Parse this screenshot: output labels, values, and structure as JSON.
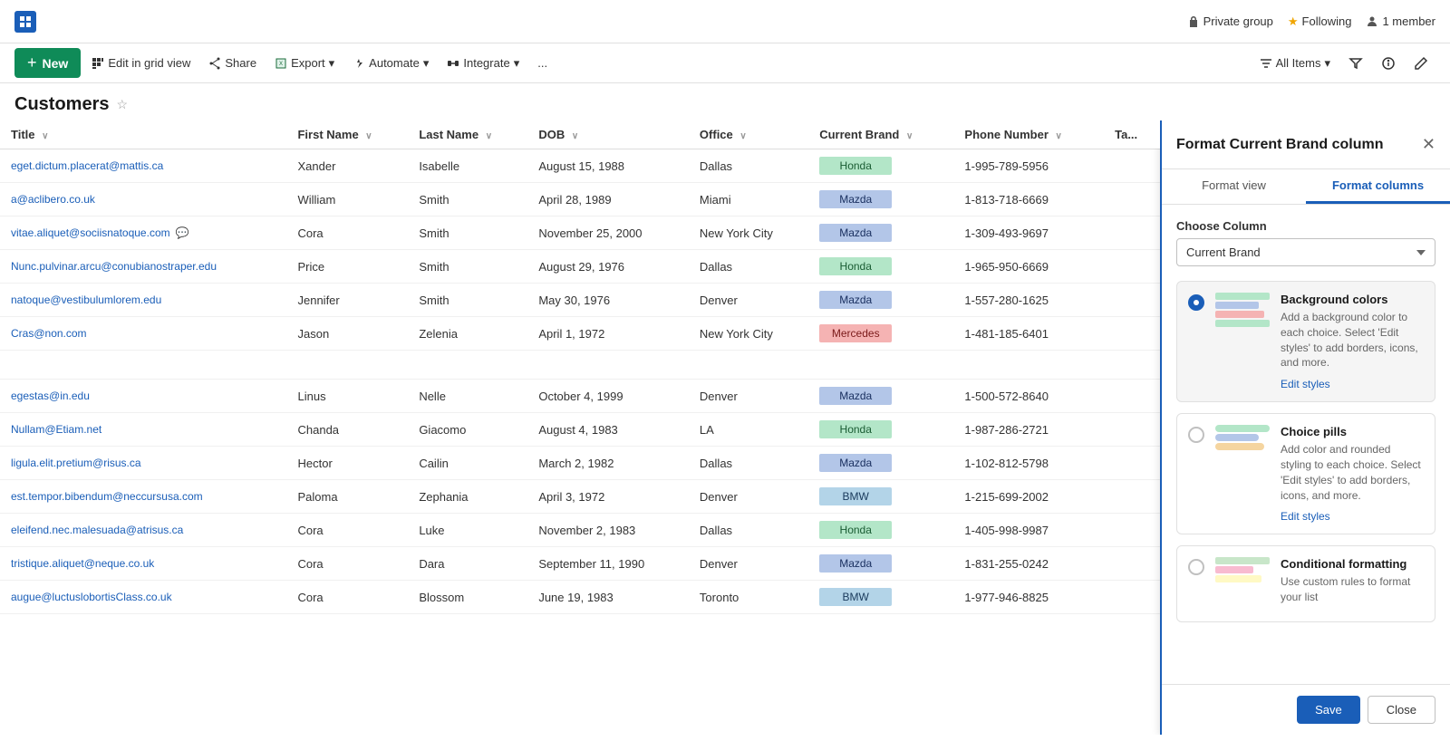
{
  "topbar": {
    "private_group": "Private group",
    "following_label": "Following",
    "member_label": "1 member"
  },
  "toolbar": {
    "new_label": "New",
    "edit_grid_label": "Edit in grid view",
    "share_label": "Share",
    "export_label": "Export",
    "automate_label": "Automate",
    "integrate_label": "Integrate",
    "more_label": "...",
    "all_items_label": "All Items"
  },
  "page": {
    "title": "Customers"
  },
  "table": {
    "columns": [
      "Title",
      "First Name",
      "Last Name",
      "DOB",
      "Office",
      "Current Brand",
      "Phone Number",
      "Ta..."
    ],
    "rows": [
      {
        "title": "eget.dictum.placerat@mattis.ca",
        "first_name": "Xander",
        "last_name": "Isabelle",
        "dob": "August 15, 1988",
        "office": "Dallas",
        "brand": "Honda",
        "brand_class": "brand-honda",
        "phone": "1-995-789-5956",
        "has_chat": false
      },
      {
        "title": "a@aclibero.co.uk",
        "first_name": "William",
        "last_name": "Smith",
        "dob": "April 28, 1989",
        "office": "Miami",
        "brand": "Mazda",
        "brand_class": "brand-mazda",
        "phone": "1-813-718-6669",
        "has_chat": false
      },
      {
        "title": "vitae.aliquet@sociisnatoque.com",
        "first_name": "Cora",
        "last_name": "Smith",
        "dob": "November 25, 2000",
        "office": "New York City",
        "brand": "Mazda",
        "brand_class": "brand-mazda",
        "phone": "1-309-493-9697",
        "has_chat": true
      },
      {
        "title": "Nunc.pulvinar.arcu@conubianostraper.edu",
        "first_name": "Price",
        "last_name": "Smith",
        "dob": "August 29, 1976",
        "office": "Dallas",
        "brand": "Honda",
        "brand_class": "brand-honda",
        "phone": "1-965-950-6669",
        "has_chat": false
      },
      {
        "title": "natoque@vestibulumlorem.edu",
        "first_name": "Jennifer",
        "last_name": "Smith",
        "dob": "May 30, 1976",
        "office": "Denver",
        "brand": "Mazda",
        "brand_class": "brand-mazda",
        "phone": "1-557-280-1625",
        "has_chat": false
      },
      {
        "title": "Cras@non.com",
        "first_name": "Jason",
        "last_name": "Zelenia",
        "dob": "April 1, 1972",
        "office": "New York City",
        "brand": "Mercedes",
        "brand_class": "brand-mercedes",
        "phone": "1-481-185-6401",
        "has_chat": false
      },
      {
        "title": "",
        "first_name": "",
        "last_name": "",
        "dob": "",
        "office": "",
        "brand": "",
        "brand_class": "",
        "phone": "",
        "has_chat": false
      },
      {
        "title": "egestas@in.edu",
        "first_name": "Linus",
        "last_name": "Nelle",
        "dob": "October 4, 1999",
        "office": "Denver",
        "brand": "Mazda",
        "brand_class": "brand-mazda",
        "phone": "1-500-572-8640",
        "has_chat": false
      },
      {
        "title": "Nullam@Etiam.net",
        "first_name": "Chanda",
        "last_name": "Giacomo",
        "dob": "August 4, 1983",
        "office": "LA",
        "brand": "Honda",
        "brand_class": "brand-honda",
        "phone": "1-987-286-2721",
        "has_chat": false
      },
      {
        "title": "ligula.elit.pretium@risus.ca",
        "first_name": "Hector",
        "last_name": "Cailin",
        "dob": "March 2, 1982",
        "office": "Dallas",
        "brand": "Mazda",
        "brand_class": "brand-mazda",
        "phone": "1-102-812-5798",
        "has_chat": false
      },
      {
        "title": "est.tempor.bibendum@neccursusa.com",
        "first_name": "Paloma",
        "last_name": "Zephania",
        "dob": "April 3, 1972",
        "office": "Denver",
        "brand": "BMW",
        "brand_class": "brand-bmw",
        "phone": "1-215-699-2002",
        "has_chat": false
      },
      {
        "title": "eleifend.nec.malesuada@atrisus.ca",
        "first_name": "Cora",
        "last_name": "Luke",
        "dob": "November 2, 1983",
        "office": "Dallas",
        "brand": "Honda",
        "brand_class": "brand-honda",
        "phone": "1-405-998-9987",
        "has_chat": false
      },
      {
        "title": "tristique.aliquet@neque.co.uk",
        "first_name": "Cora",
        "last_name": "Dara",
        "dob": "September 11, 1990",
        "office": "Denver",
        "brand": "Mazda",
        "brand_class": "brand-mazda",
        "phone": "1-831-255-0242",
        "has_chat": false
      },
      {
        "title": "augue@luctuslobortisClass.co.uk",
        "first_name": "Cora",
        "last_name": "Blossom",
        "dob": "June 19, 1983",
        "office": "Toronto",
        "brand": "BMW",
        "brand_class": "brand-bmw",
        "phone": "1-977-946-8825",
        "has_chat": false
      }
    ]
  },
  "format_panel": {
    "title": "Format Current Brand column",
    "tab_format_view": "Format view",
    "tab_format_columns": "Format columns",
    "choose_column_label": "Choose Column",
    "choose_column_value": "Current Brand",
    "options": [
      {
        "id": "background-colors",
        "title": "Background colors",
        "description": "Add a background color to each choice. Select 'Edit styles' to add borders, icons, and more.",
        "edit_styles_label": "Edit styles",
        "selected": true
      },
      {
        "id": "choice-pills",
        "title": "Choice pills",
        "description": "Add color and rounded styling to each choice. Select 'Edit styles' to add borders, icons, and more.",
        "edit_styles_label": "Edit styles",
        "selected": false
      },
      {
        "id": "conditional-formatting",
        "title": "Conditional formatting",
        "description": "Use custom rules to format your list",
        "edit_styles_label": "",
        "selected": false
      }
    ],
    "save_label": "Save",
    "close_label": "Close"
  }
}
